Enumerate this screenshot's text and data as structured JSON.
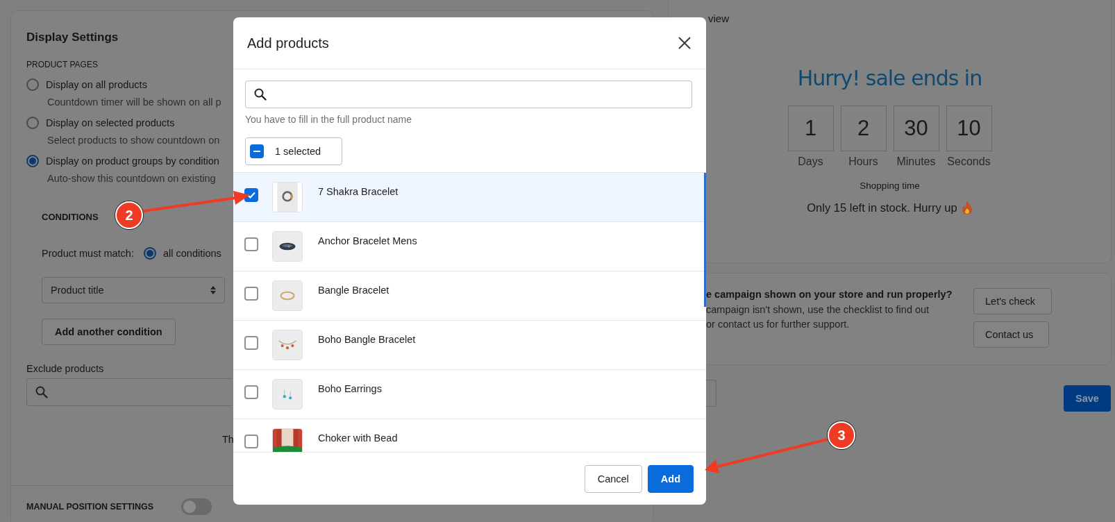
{
  "settings": {
    "title": "Display Settings",
    "section": "PRODUCT PAGES",
    "options": [
      {
        "label": "Display on all products",
        "description": "Countdown timer will be shown on all p",
        "selected": false
      },
      {
        "label": "Display on selected products",
        "description": "Select products to show countdown on",
        "selected": false
      },
      {
        "label": "Display on product groups by condition",
        "description": "Auto-show this countdown on existing",
        "selected": true
      }
    ],
    "conditions": {
      "heading": "CONDITIONS",
      "match_label": "Product must match:",
      "match_option": {
        "label": "all conditions",
        "selected": true
      },
      "field": "Product title",
      "add_button": "Add another condition"
    },
    "exclude": {
      "label": "Exclude products"
    },
    "note": "Th",
    "manual_position": {
      "label": "MANUAL POSITION SETTINGS",
      "on": false
    }
  },
  "preview": {
    "title": "view",
    "heading": "Hurry! sale ends in",
    "units": [
      {
        "value": "1",
        "label": "Days"
      },
      {
        "value": "2",
        "label": "Hours"
      },
      {
        "value": "30",
        "label": "Minutes"
      },
      {
        "value": "10",
        "label": "Seconds"
      }
    ],
    "caption": "Shopping time",
    "stock": "Only 15 left in stock. Hurry up"
  },
  "help": {
    "question": "e campaign shown on your store and run properly?",
    "lines": [
      "campaign isn't shown, use the checklist to find out",
      "or contact us for further support."
    ],
    "buttons": [
      "Let's check",
      "Contact us"
    ]
  },
  "footer": {
    "save": "Save"
  },
  "dialog": {
    "title": "Add products",
    "search": {
      "hint": "You have to fill in the full product name"
    },
    "bulk": {
      "label": "1 selected",
      "indeterminate": true
    },
    "products": [
      {
        "name": "7 Shakra Bracelet",
        "checked": true,
        "kind": "picture"
      },
      {
        "name": "Anchor Bracelet Mens",
        "checked": false,
        "kind": "picture"
      },
      {
        "name": "Bangle Bracelet",
        "checked": false,
        "kind": "picture"
      },
      {
        "name": "Boho Bangle Bracelet",
        "checked": false,
        "kind": "picture"
      },
      {
        "name": "Boho Earrings",
        "checked": false,
        "kind": "picture"
      },
      {
        "name": "Choker with Bead",
        "checked": false,
        "kind": "picture"
      }
    ],
    "buttons": [
      {
        "label": "Cancel",
        "kind": "secondary"
      },
      {
        "label": "Add",
        "kind": "primary"
      }
    ]
  },
  "annotations": [
    {
      "label": "2"
    },
    {
      "label": "3"
    }
  ]
}
